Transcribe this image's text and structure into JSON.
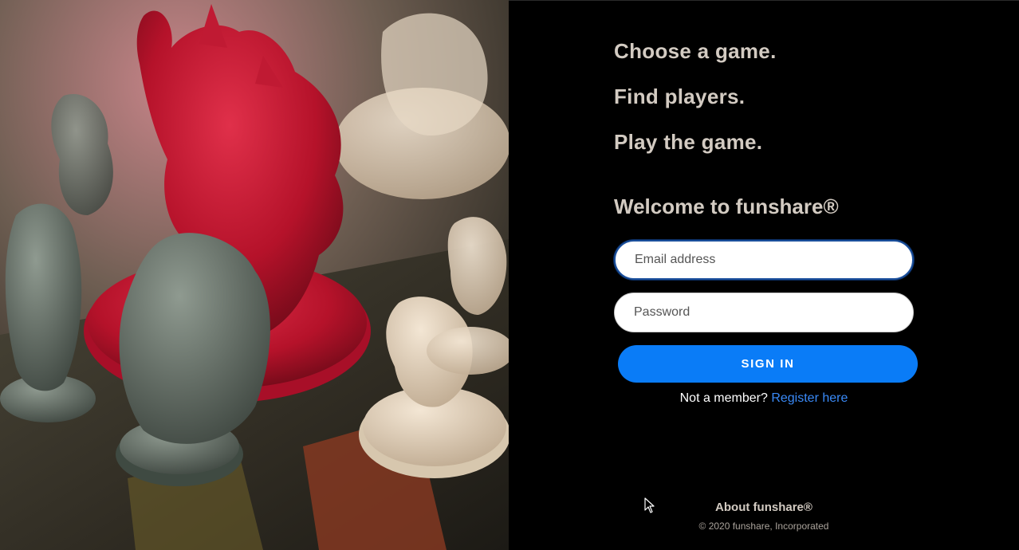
{
  "hero": {
    "image_alt": "Board game miniatures: red monster figure surrounded by grey and beige figurines"
  },
  "taglines": [
    "Choose a game.",
    "Find players.",
    "Play the game."
  ],
  "welcome": "Welcome to funshare®",
  "form": {
    "email_placeholder": "Email address",
    "password_placeholder": "Password",
    "signin_label": "SIGN IN",
    "not_member_text": "Not a member?",
    "register_link": "Register here"
  },
  "footer": {
    "about": "About funshare®",
    "copyright": "© 2020 funshare, Incorporated"
  },
  "colors": {
    "accent": "#0a7cf7",
    "link": "#3a8af7",
    "heading": "#d3cbc2",
    "background": "#000000"
  }
}
